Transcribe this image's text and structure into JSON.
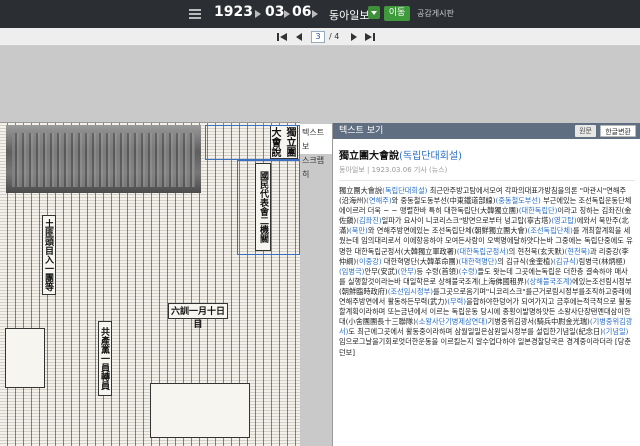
{
  "header": {
    "year": "1923",
    "month": "03",
    "day": "06",
    "paper": "동아일보",
    "go_label": "이동",
    "link_label": "공감게시판",
    "icons": [
      "menu-icon",
      "prev-icon",
      "next-icon",
      "dropdown-icon"
    ]
  },
  "pager": {
    "current": "3",
    "total": "/ 4"
  },
  "newspaper": {
    "headline_main": "獨立團大會說",
    "headline_second": "國民代表會二機關",
    "side_headline_1": "土匪頭目入一團等",
    "side_headline_2": "六訓一月十日目",
    "side_headline_3": "共產黨一員轉員"
  },
  "side_tab": {
    "line1": "텍스트 보",
    "line2": "스크랩 히"
  },
  "panel": {
    "title": "텍스트 보기",
    "btn_original": "원문",
    "btn_convert": "한글변환",
    "article_title": "獨立團大會說",
    "article_title_sub": "(독립단대회설)",
    "meta": "동아일보 | 1923.03.06 기사 (뉴스)",
    "body_segments": [
      {
        "t": "獨立團大會說",
        "h": false
      },
      {
        "t": "(독립단대회설)",
        "h": true
      },
      {
        "t": " 최근만주방고탐에서모여 각파의대표가방침을의론 \"마관시\"연해주(沿海州)",
        "h": false
      },
      {
        "t": "(연해주)",
        "h": true
      },
      {
        "t": "와 중동철도동부선(中東鐵道部線)",
        "h": false
      },
      {
        "t": "(중동철도부선)",
        "h": true
      },
      {
        "t": " 부근에있는 조선독립운동단체에이르러 더욱 ~ ~ 맹렬한바 특히 대한독립단(大韓獨立團)",
        "h": false
      },
      {
        "t": "(대한독립단)",
        "h": true
      },
      {
        "t": "이라고 칭하는 김좌진(金佐鎭)",
        "h": false
      },
      {
        "t": "(김좌진)",
        "h": true
      },
      {
        "t": "일파가 요사이 니코리스크\"방면으로부터 넝고탑(寧古塔)",
        "h": false
      },
      {
        "t": "(영고탑)",
        "h": true
      },
      {
        "t": "에와서 북만주(北滿)",
        "h": false
      },
      {
        "t": "(북만)",
        "h": true
      },
      {
        "t": "와 연해주방면에있는 조선독립단체(朝鮮獨立團大會)",
        "h": false
      },
      {
        "t": "(조선독립단체)",
        "h": true
      },
      {
        "t": "를 개최할계획을 세웠는데 임의대리로서 이에항응하야 모여든사람이 오백명에달하얏다는바 그중에는 독립단중에도 유명한 대한독립군정서(大韓獨立軍政署)",
        "h": false
      },
      {
        "t": "(대한독립군정서)",
        "h": true
      },
      {
        "t": "의 현천묵(玄天默)",
        "h": false
      },
      {
        "t": "(현천묵)",
        "h": true
      },
      {
        "t": "과 리중강(李仲綱)",
        "h": false
      },
      {
        "t": "(이중강)",
        "h": true
      },
      {
        "t": " 대한혁명단(大韓革命團)",
        "h": false
      },
      {
        "t": "(대한혁명단)",
        "h": true
      },
      {
        "t": "의 김규식(金奎植)",
        "h": false
      },
      {
        "t": "(김규식)",
        "h": true
      },
      {
        "t": "림병극(林炳極)",
        "h": false
      },
      {
        "t": "(임병극)",
        "h": true
      },
      {
        "t": "안무(安武)",
        "h": false
      },
      {
        "t": "(안무)",
        "h": true
      },
      {
        "t": "등 수령(首領)",
        "h": false
      },
      {
        "t": "(수령)",
        "h": true
      },
      {
        "t": "들도 왓는데 그곳에는독립운 더한층 결속하야 매사를 실행할것이라는바 대일학은로 상해불국조계(上海佛國租界)",
        "h": false
      },
      {
        "t": "(상해불국조계)",
        "h": true
      },
      {
        "t": "에있는조선림시정부(朝鮮臨時政府)",
        "h": false
      },
      {
        "t": "(조선임시정부)",
        "h": true
      },
      {
        "t": "를그곳으로옴기며\"니코리스크\"를근거로림시정부를조직하고중래에 연해주방면에서 활동하든무력(武力)",
        "h": false
      },
      {
        "t": "(무력)",
        "h": true
      },
      {
        "t": "을합하야한덩어가 되여가지고 금후에는적극적으로 활동할계획이라하며 또는금년에서 이르는 독립운동 당시에 종횡이발명하얏든 소왕사단장탠멘대삼이한대(小舍團團長十三聯隊)",
        "h": false
      },
      {
        "t": "(소왕사단기병제삼연대)",
        "h": true
      },
      {
        "t": "기병중위김광서(騎兵中尉金光瑞)",
        "h": false
      },
      {
        "t": "(기병중위김광서)",
        "h": true
      },
      {
        "t": "도 최근에그곳에서 활동중이라하며 삼월일일은삼원일시정부를 설립한기념일(紀念日)",
        "h": false
      },
      {
        "t": "(기념일)",
        "h": true
      },
      {
        "t": "임으로그날을기회로엇더한운동을 이르킬는지 알수업다하야 일본경찰당국은 경계중이라더라 [당춘던보]",
        "h": false
      }
    ]
  }
}
